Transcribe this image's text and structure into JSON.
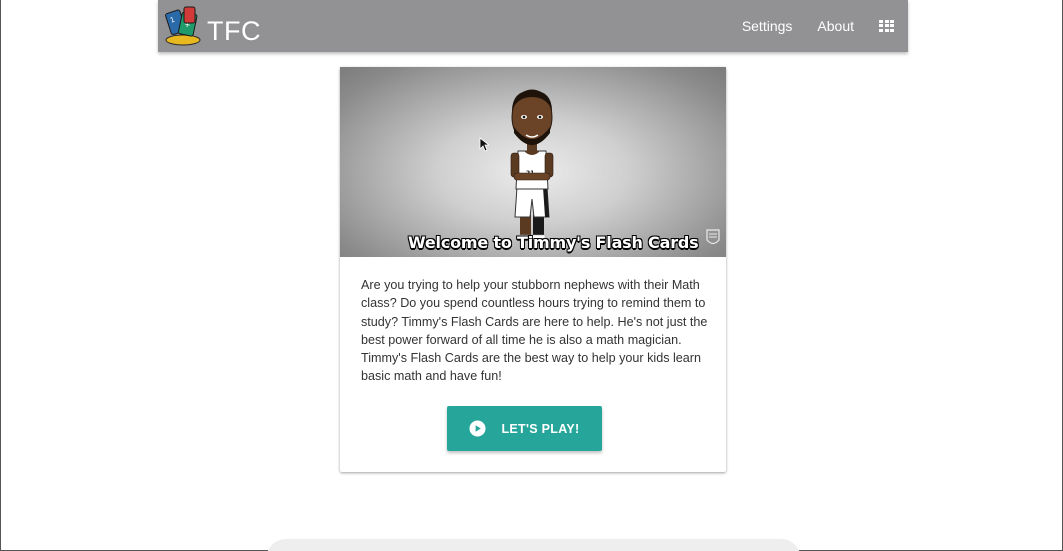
{
  "navbar": {
    "brand": "TFC",
    "links": {
      "settings": "Settings",
      "about": "About"
    },
    "icons": {
      "logo": "flash-cards-logo-icon",
      "apps": "apps-grid-icon"
    },
    "background": "#929295"
  },
  "card": {
    "image_caption": "Welcome to Timmy's Flash Cards",
    "description": "Are you trying to help your stubborn nephews with their Math class? Do you spend countless hours trying to remind them to study? Timmy's Flash Cards are here to help. He's not just the best power forward of all time he is also a math magician. Timmy's Flash Cards are the best way to help your kids learn basic math and have fun!",
    "button_label": "LET'S PLAY!",
    "button_icon": "play-circle-icon",
    "button_color": "#26a69a"
  }
}
